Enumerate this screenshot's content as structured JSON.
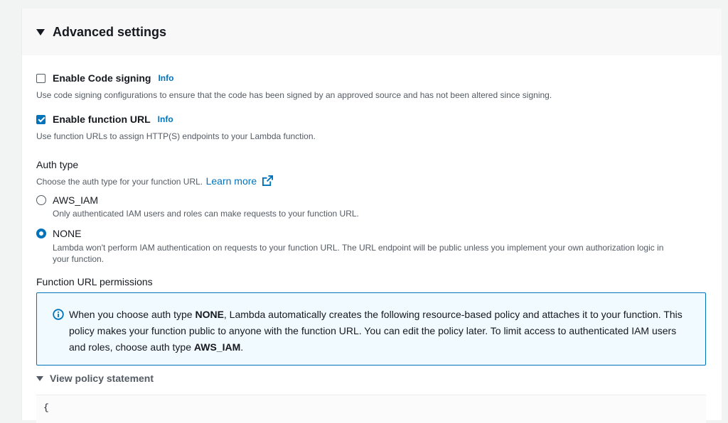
{
  "section": {
    "title": "Advanced settings"
  },
  "code_signing": {
    "label": "Enable Code signing",
    "info": "Info",
    "checked": false,
    "description": "Use code signing configurations to ensure that the code has been signed by an approved source and has not been altered since signing."
  },
  "function_url": {
    "label": "Enable function URL",
    "info": "Info",
    "checked": true,
    "description": "Use function URLs to assign HTTP(S) endpoints to your Lambda function."
  },
  "auth_type": {
    "label": "Auth type",
    "description": "Choose the auth type for your function URL.",
    "learn_more": "Learn more",
    "options": [
      {
        "label": "AWS_IAM",
        "description": "Only authenticated IAM users and roles can make requests to your function URL.",
        "selected": false
      },
      {
        "label": "NONE",
        "description_line1": "Lambda won't perform IAM authentication on requests to your function URL. The URL endpoint will be public unless you implement your own authorization logic in",
        "description_line2": "your function.",
        "selected": true
      }
    ]
  },
  "permissions": {
    "label": "Function URL permissions",
    "alert": {
      "part1": "When you choose auth type ",
      "bold1": "NONE",
      "part2": ", Lambda automatically creates the following resource-based policy and attaches it to your function. This policy makes your function public to anyone with the function URL. You can edit the policy later. To limit access to authenticated IAM users and roles, choose auth type ",
      "bold2": "AWS_IAM",
      "part3": "."
    },
    "view_policy": "View policy statement",
    "code_first_line": "{"
  },
  "colors": {
    "accent": "#0073bb",
    "text": "#16191f",
    "muted": "#545b64",
    "alert_bg": "#f1faff"
  }
}
